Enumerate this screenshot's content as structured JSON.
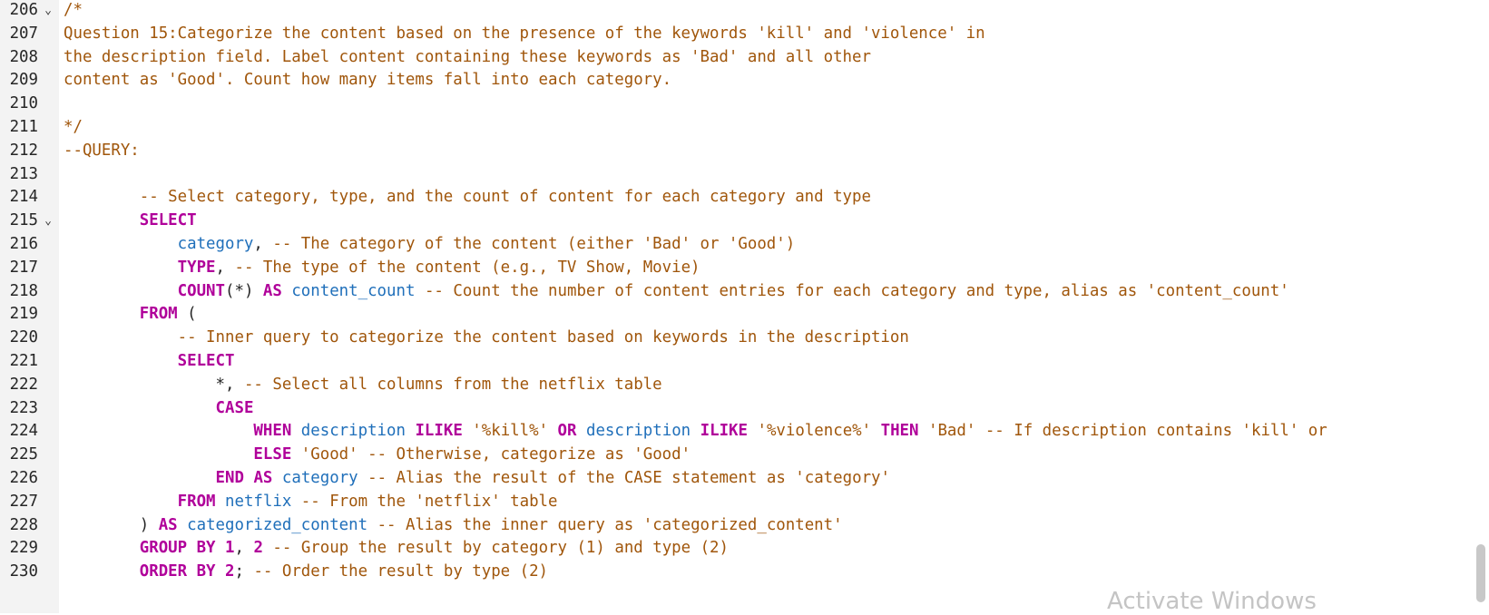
{
  "colors": {
    "gutter_bg": "#f3f3f3",
    "comment": "#a0560b",
    "keyword": "#b0009a",
    "identifier": "#1f6fba",
    "plain": "#262626",
    "watermark": "#c4c4c4"
  },
  "editor": {
    "lines": [
      {
        "number": "206",
        "fold": "⌄",
        "tokens": [
          {
            "t": "/*",
            "k": "comment"
          }
        ]
      },
      {
        "number": "207",
        "fold": "",
        "tokens": [
          {
            "t": "Question 15:Categorize the content based on the presence of the keywords 'kill' and 'violence' in",
            "k": "comment"
          }
        ]
      },
      {
        "number": "208",
        "fold": "",
        "tokens": [
          {
            "t": "the description field. Label content containing these keywords as 'Bad' and all other",
            "k": "comment"
          }
        ]
      },
      {
        "number": "209",
        "fold": "",
        "tokens": [
          {
            "t": "content as 'Good'. Count how many items fall into each category.",
            "k": "comment"
          }
        ]
      },
      {
        "number": "210",
        "fold": "",
        "tokens": []
      },
      {
        "number": "211",
        "fold": "",
        "tokens": [
          {
            "t": "*/",
            "k": "comment"
          }
        ]
      },
      {
        "number": "212",
        "fold": "",
        "tokens": [
          {
            "t": "--QUERY:",
            "k": "comment"
          }
        ]
      },
      {
        "number": "213",
        "fold": "",
        "tokens": []
      },
      {
        "number": "214",
        "fold": "",
        "tokens": [
          {
            "t": "        ",
            "k": "plain"
          },
          {
            "t": "-- Select category, type, and the count of content for each category and type",
            "k": "comment"
          }
        ]
      },
      {
        "number": "215",
        "fold": "⌄",
        "tokens": [
          {
            "t": "        ",
            "k": "plain"
          },
          {
            "t": "SELECT",
            "k": "keyword"
          }
        ]
      },
      {
        "number": "216",
        "fold": "",
        "tokens": [
          {
            "t": "            ",
            "k": "plain"
          },
          {
            "t": "category",
            "k": "ident"
          },
          {
            "t": ", ",
            "k": "plain"
          },
          {
            "t": "-- The category of the content (either 'Bad' or 'Good')",
            "k": "comment"
          }
        ]
      },
      {
        "number": "217",
        "fold": "",
        "tokens": [
          {
            "t": "            ",
            "k": "plain"
          },
          {
            "t": "TYPE",
            "k": "keyword"
          },
          {
            "t": ", ",
            "k": "plain"
          },
          {
            "t": "-- The type of the content (e.g., TV Show, Movie)",
            "k": "comment"
          }
        ]
      },
      {
        "number": "218",
        "fold": "",
        "tokens": [
          {
            "t": "            ",
            "k": "plain"
          },
          {
            "t": "COUNT",
            "k": "keyword"
          },
          {
            "t": "(*) ",
            "k": "plain"
          },
          {
            "t": "AS",
            "k": "keyword"
          },
          {
            "t": " ",
            "k": "plain"
          },
          {
            "t": "content_count",
            "k": "ident"
          },
          {
            "t": " ",
            "k": "plain"
          },
          {
            "t": "-- Count the number of content entries for each category and type, alias as 'content_count'",
            "k": "comment"
          }
        ]
      },
      {
        "number": "219",
        "fold": "",
        "tokens": [
          {
            "t": "        ",
            "k": "plain"
          },
          {
            "t": "FROM",
            "k": "keyword"
          },
          {
            "t": " (",
            "k": "plain"
          }
        ]
      },
      {
        "number": "220",
        "fold": "",
        "tokens": [
          {
            "t": "            ",
            "k": "plain"
          },
          {
            "t": "-- Inner query to categorize the content based on keywords in the description",
            "k": "comment"
          }
        ]
      },
      {
        "number": "221",
        "fold": "",
        "tokens": [
          {
            "t": "            ",
            "k": "plain"
          },
          {
            "t": "SELECT",
            "k": "keyword"
          }
        ]
      },
      {
        "number": "222",
        "fold": "",
        "tokens": [
          {
            "t": "                *, ",
            "k": "plain"
          },
          {
            "t": "-- Select all columns from the netflix table",
            "k": "comment"
          }
        ]
      },
      {
        "number": "223",
        "fold": "",
        "tokens": [
          {
            "t": "                ",
            "k": "plain"
          },
          {
            "t": "CASE",
            "k": "keyword"
          }
        ]
      },
      {
        "number": "224",
        "fold": "",
        "tokens": [
          {
            "t": "                    ",
            "k": "plain"
          },
          {
            "t": "WHEN",
            "k": "keyword"
          },
          {
            "t": " ",
            "k": "plain"
          },
          {
            "t": "description",
            "k": "ident"
          },
          {
            "t": " ",
            "k": "plain"
          },
          {
            "t": "ILIKE",
            "k": "keyword"
          },
          {
            "t": " ",
            "k": "plain"
          },
          {
            "t": "'%kill%'",
            "k": "comment"
          },
          {
            "t": " ",
            "k": "plain"
          },
          {
            "t": "OR",
            "k": "keyword"
          },
          {
            "t": " ",
            "k": "plain"
          },
          {
            "t": "description",
            "k": "ident"
          },
          {
            "t": " ",
            "k": "plain"
          },
          {
            "t": "ILIKE",
            "k": "keyword"
          },
          {
            "t": " ",
            "k": "plain"
          },
          {
            "t": "'%violence%'",
            "k": "comment"
          },
          {
            "t": " ",
            "k": "plain"
          },
          {
            "t": "THEN",
            "k": "keyword"
          },
          {
            "t": " ",
            "k": "plain"
          },
          {
            "t": "'Bad'",
            "k": "comment"
          },
          {
            "t": " ",
            "k": "plain"
          },
          {
            "t": "-- If description contains 'kill' or",
            "k": "comment"
          }
        ]
      },
      {
        "number": "225",
        "fold": "",
        "tokens": [
          {
            "t": "                    ",
            "k": "plain"
          },
          {
            "t": "ELSE",
            "k": "keyword"
          },
          {
            "t": " ",
            "k": "plain"
          },
          {
            "t": "'Good'",
            "k": "comment"
          },
          {
            "t": " ",
            "k": "plain"
          },
          {
            "t": "-- Otherwise, categorize as 'Good'",
            "k": "comment"
          }
        ]
      },
      {
        "number": "226",
        "fold": "",
        "tokens": [
          {
            "t": "                ",
            "k": "plain"
          },
          {
            "t": "END",
            "k": "keyword"
          },
          {
            "t": " ",
            "k": "plain"
          },
          {
            "t": "AS",
            "k": "keyword"
          },
          {
            "t": " ",
            "k": "plain"
          },
          {
            "t": "category",
            "k": "ident"
          },
          {
            "t": " ",
            "k": "plain"
          },
          {
            "t": "-- Alias the result of the CASE statement as 'category'",
            "k": "comment"
          }
        ]
      },
      {
        "number": "227",
        "fold": "",
        "tokens": [
          {
            "t": "            ",
            "k": "plain"
          },
          {
            "t": "FROM",
            "k": "keyword"
          },
          {
            "t": " ",
            "k": "plain"
          },
          {
            "t": "netflix",
            "k": "ident"
          },
          {
            "t": " ",
            "k": "plain"
          },
          {
            "t": "-- From the 'netflix' table",
            "k": "comment"
          }
        ]
      },
      {
        "number": "228",
        "fold": "",
        "tokens": [
          {
            "t": "        ) ",
            "k": "plain"
          },
          {
            "t": "AS",
            "k": "keyword"
          },
          {
            "t": " ",
            "k": "plain"
          },
          {
            "t": "categorized_content",
            "k": "ident"
          },
          {
            "t": " ",
            "k": "plain"
          },
          {
            "t": "-- Alias the inner query as 'categorized_content'",
            "k": "comment"
          }
        ]
      },
      {
        "number": "229",
        "fold": "",
        "tokens": [
          {
            "t": "        ",
            "k": "plain"
          },
          {
            "t": "GROUP BY",
            "k": "keyword"
          },
          {
            "t": " ",
            "k": "plain"
          },
          {
            "t": "1",
            "k": "keyword"
          },
          {
            "t": ", ",
            "k": "plain"
          },
          {
            "t": "2",
            "k": "keyword"
          },
          {
            "t": " ",
            "k": "plain"
          },
          {
            "t": "-- Group the result by category (1) and type (2)",
            "k": "comment"
          }
        ]
      },
      {
        "number": "230",
        "fold": "",
        "tokens": [
          {
            "t": "        ",
            "k": "plain"
          },
          {
            "t": "ORDER BY",
            "k": "keyword"
          },
          {
            "t": " ",
            "k": "plain"
          },
          {
            "t": "2",
            "k": "keyword"
          },
          {
            "t": "; ",
            "k": "plain"
          },
          {
            "t": "-- Order the result by type (2)",
            "k": "comment"
          }
        ]
      }
    ]
  },
  "watermark": {
    "text": "Activate Windows"
  }
}
